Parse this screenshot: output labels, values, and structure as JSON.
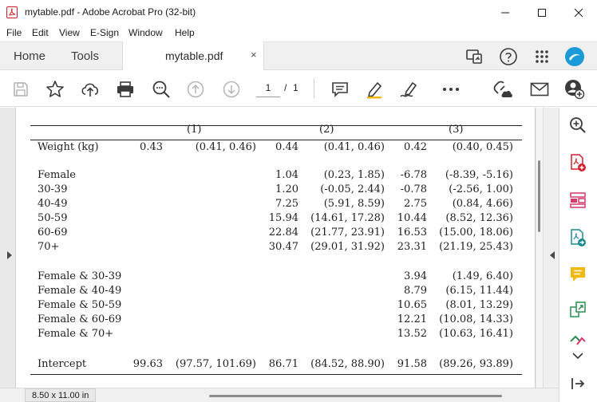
{
  "window": {
    "title": "mytable.pdf - Adobe Acrobat Pro (32-bit)",
    "controls": {
      "minimize": "minimize-icon",
      "maximize": "maximize-icon",
      "close": "close-icon"
    }
  },
  "menu": [
    "File",
    "Edit",
    "View",
    "E-Sign",
    "Window",
    "Help"
  ],
  "tabs": {
    "home": "Home",
    "tools": "Tools",
    "document": "mytable.pdf",
    "close_glyph": "×"
  },
  "toolbar": {
    "page_current": "1",
    "page_separator": "/",
    "page_total": "1",
    "icons": [
      "save-icon",
      "bookmark-star-icon",
      "upload-cloud-icon",
      "print-icon",
      "zoom-search-icon",
      "page-up-icon",
      "page-down-icon",
      "comment-icon",
      "highlight-pen-icon",
      "sign-icon",
      "more-icon",
      "share-link-icon",
      "email-icon",
      "account-icon"
    ]
  },
  "table": {
    "headers": [
      "(1)",
      "(2)",
      "(3)"
    ],
    "rows": [
      {
        "label": "Weight (kg)",
        "c1": "0.43",
        "c1ci": "(0.41, 0.46)",
        "c2": "0.44",
        "c2ci": "(0.41, 0.46)",
        "c3": "0.42",
        "c3ci": "(0.40, 0.45)"
      },
      {
        "label": "Female",
        "c1": "",
        "c1ci": "",
        "c2": "1.04",
        "c2ci": "(0.23, 1.85)",
        "c3": "-6.78",
        "c3ci": "(-8.39, -5.16)"
      },
      {
        "label": "30-39",
        "c1": "",
        "c1ci": "",
        "c2": "1.20",
        "c2ci": "(-0.05, 2.44)",
        "c3": "-0.78",
        "c3ci": "(-2.56, 1.00)"
      },
      {
        "label": "40-49",
        "c1": "",
        "c1ci": "",
        "c2": "7.25",
        "c2ci": "(5.91, 8.59)",
        "c3": "2.75",
        "c3ci": "(0.84, 4.66)"
      },
      {
        "label": "50-59",
        "c1": "",
        "c1ci": "",
        "c2": "15.94",
        "c2ci": "(14.61, 17.28)",
        "c3": "10.44",
        "c3ci": "(8.52, 12.36)"
      },
      {
        "label": "60-69",
        "c1": "",
        "c1ci": "",
        "c2": "22.84",
        "c2ci": "(21.77, 23.91)",
        "c3": "16.53",
        "c3ci": "(15.00, 18.06)"
      },
      {
        "label": "70+",
        "c1": "",
        "c1ci": "",
        "c2": "30.47",
        "c2ci": "(29.01, 31.92)",
        "c3": "23.31",
        "c3ci": "(21.19, 25.43)"
      },
      {
        "label": "Female & 30-39",
        "c1": "",
        "c1ci": "",
        "c2": "",
        "c2ci": "",
        "c3": "3.94",
        "c3ci": "(1.49, 6.40)"
      },
      {
        "label": "Female & 40-49",
        "c1": "",
        "c1ci": "",
        "c2": "",
        "c2ci": "",
        "c3": "8.79",
        "c3ci": "(6.15, 11.44)"
      },
      {
        "label": "Female & 50-59",
        "c1": "",
        "c1ci": "",
        "c2": "",
        "c2ci": "",
        "c3": "10.65",
        "c3ci": "(8.01, 13.29)"
      },
      {
        "label": "Female & 60-69",
        "c1": "",
        "c1ci": "",
        "c2": "",
        "c2ci": "",
        "c3": "12.21",
        "c3ci": "(10.08, 14.33)"
      },
      {
        "label": "Female & 70+",
        "c1": "",
        "c1ci": "",
        "c2": "",
        "c2ci": "",
        "c3": "13.52",
        "c3ci": "(10.63, 16.41)"
      },
      {
        "label": "Intercept",
        "c1": "99.63",
        "c1ci": "(97.57, 101.69)",
        "c2": "86.71",
        "c2ci": "(84.52, 88.90)",
        "c3": "91.58",
        "c3ci": "(89.26, 93.89)"
      }
    ]
  },
  "right_panel": {
    "icons": [
      "zoom-in-icon",
      "create-pdf-icon",
      "organize-pages-icon",
      "export-pdf-icon",
      "comment-tool-icon",
      "compress-pdf-icon",
      "edit-pdf-icon",
      "expand-more-icon",
      "collapse-panel-icon"
    ]
  },
  "status": {
    "page_size": "8.50 x 11.00 in"
  },
  "colors": {
    "acrobat_red": "#d4202a",
    "comment_yellow": "#f2b90c",
    "export_teal": "#1b8a8f",
    "edit_pink": "#d6396a",
    "compress_green": "#2a8d4f",
    "account_blue": "#1a7fd6"
  }
}
